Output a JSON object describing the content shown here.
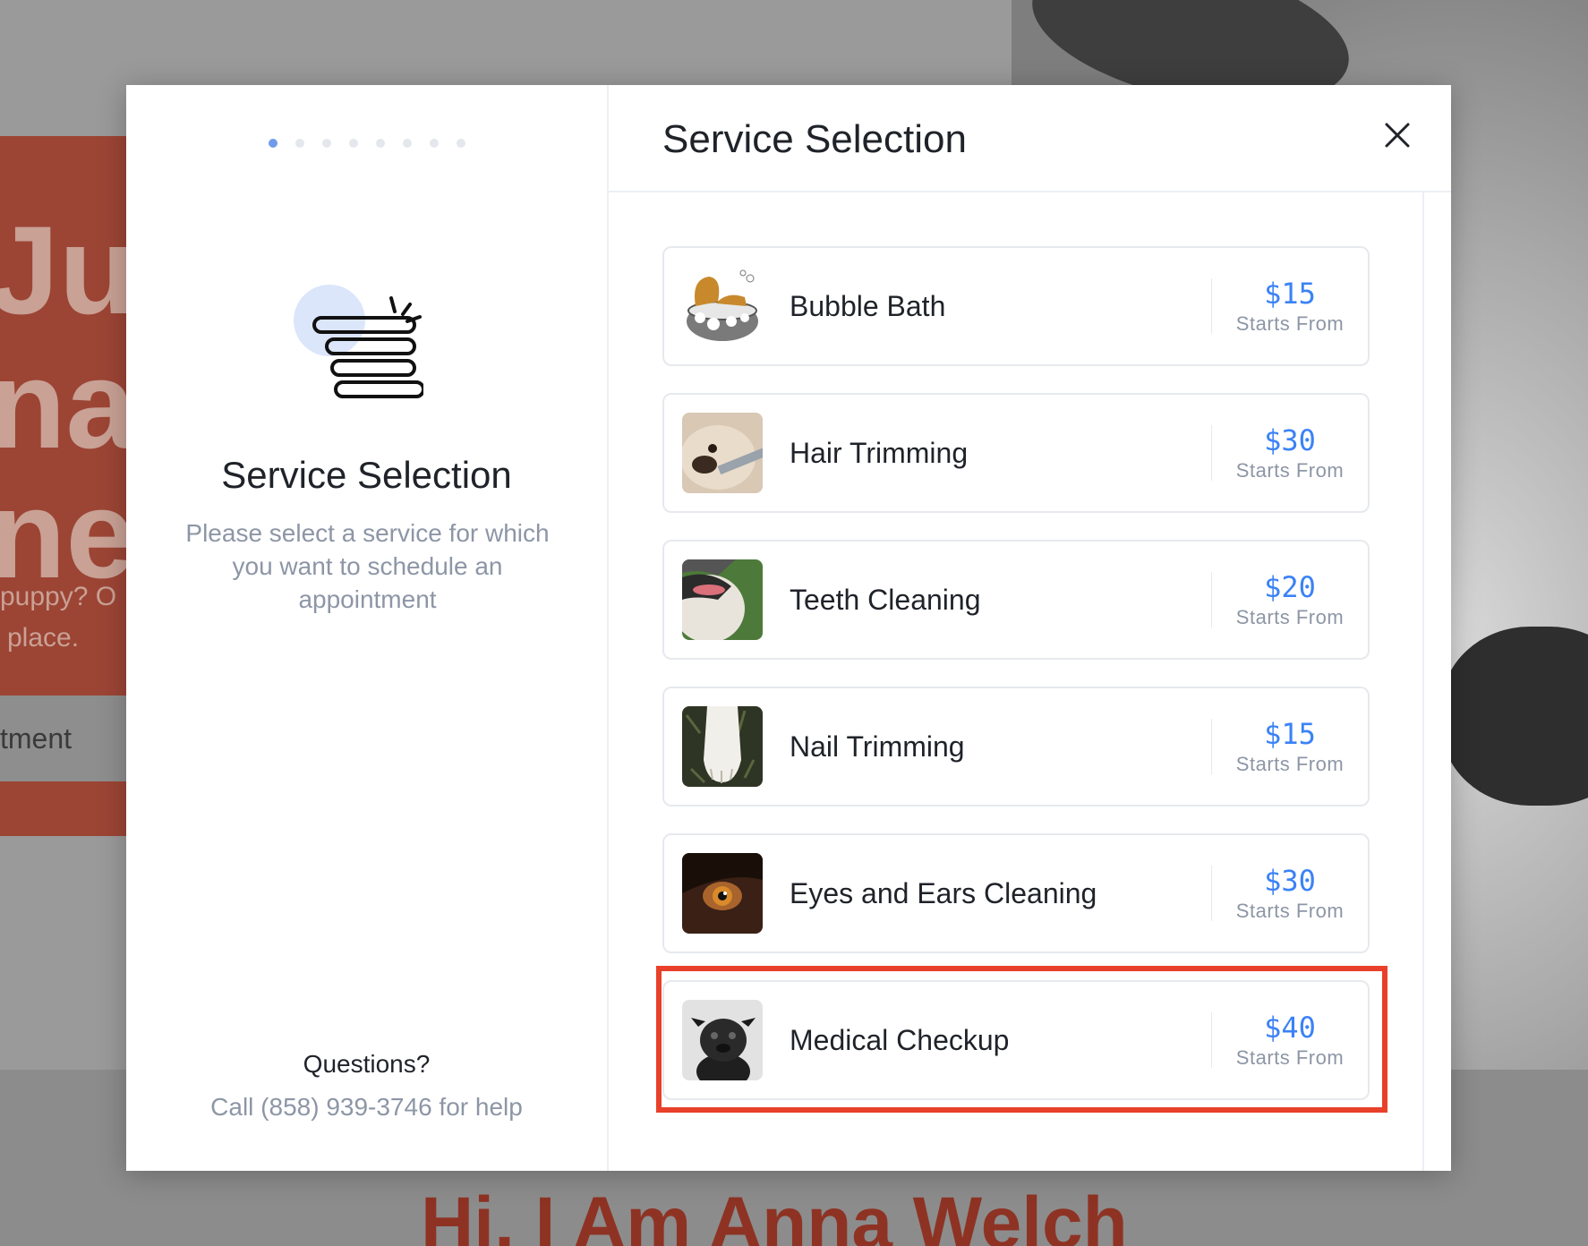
{
  "background": {
    "hero_lines": [
      "Jus",
      "nar",
      "ne."
    ],
    "hero_small": [
      "puppy? O",
      "place."
    ],
    "hero_button": "tment",
    "bottom_title": "Hi, I Am Anna Welch"
  },
  "modal": {
    "steps": {
      "total": 8,
      "current": 1
    },
    "left": {
      "illustration_icon": "stacked-list-icon",
      "title": "Service Selection",
      "description": "Please select a service for which you want to schedule an appointment",
      "questions_label": "Questions?",
      "help_text": "Call (858) 939-3746 for help"
    },
    "right": {
      "title": "Service Selection",
      "close_icon": "close-icon",
      "services": [
        {
          "name": "Bubble Bath",
          "price": "$15",
          "sub": "Starts From",
          "image": "dog-in-tub"
        },
        {
          "name": "Hair Trimming",
          "price": "$30",
          "sub": "Starts From",
          "image": "dog-hair-clippers"
        },
        {
          "name": "Teeth Cleaning",
          "price": "$20",
          "sub": "Starts From",
          "image": "dog-mouth"
        },
        {
          "name": "Nail Trimming",
          "price": "$15",
          "sub": "Starts From",
          "image": "dog-paw"
        },
        {
          "name": "Eyes and Ears Cleaning",
          "price": "$30",
          "sub": "Starts From",
          "image": "dog-eye"
        },
        {
          "name": "Medical Checkup",
          "price": "$40",
          "sub": "Starts From",
          "image": "black-pug"
        }
      ]
    }
  },
  "colors": {
    "accent": "#3b82f6",
    "highlight": "#e8402a",
    "step_active": "#6f9cea"
  }
}
